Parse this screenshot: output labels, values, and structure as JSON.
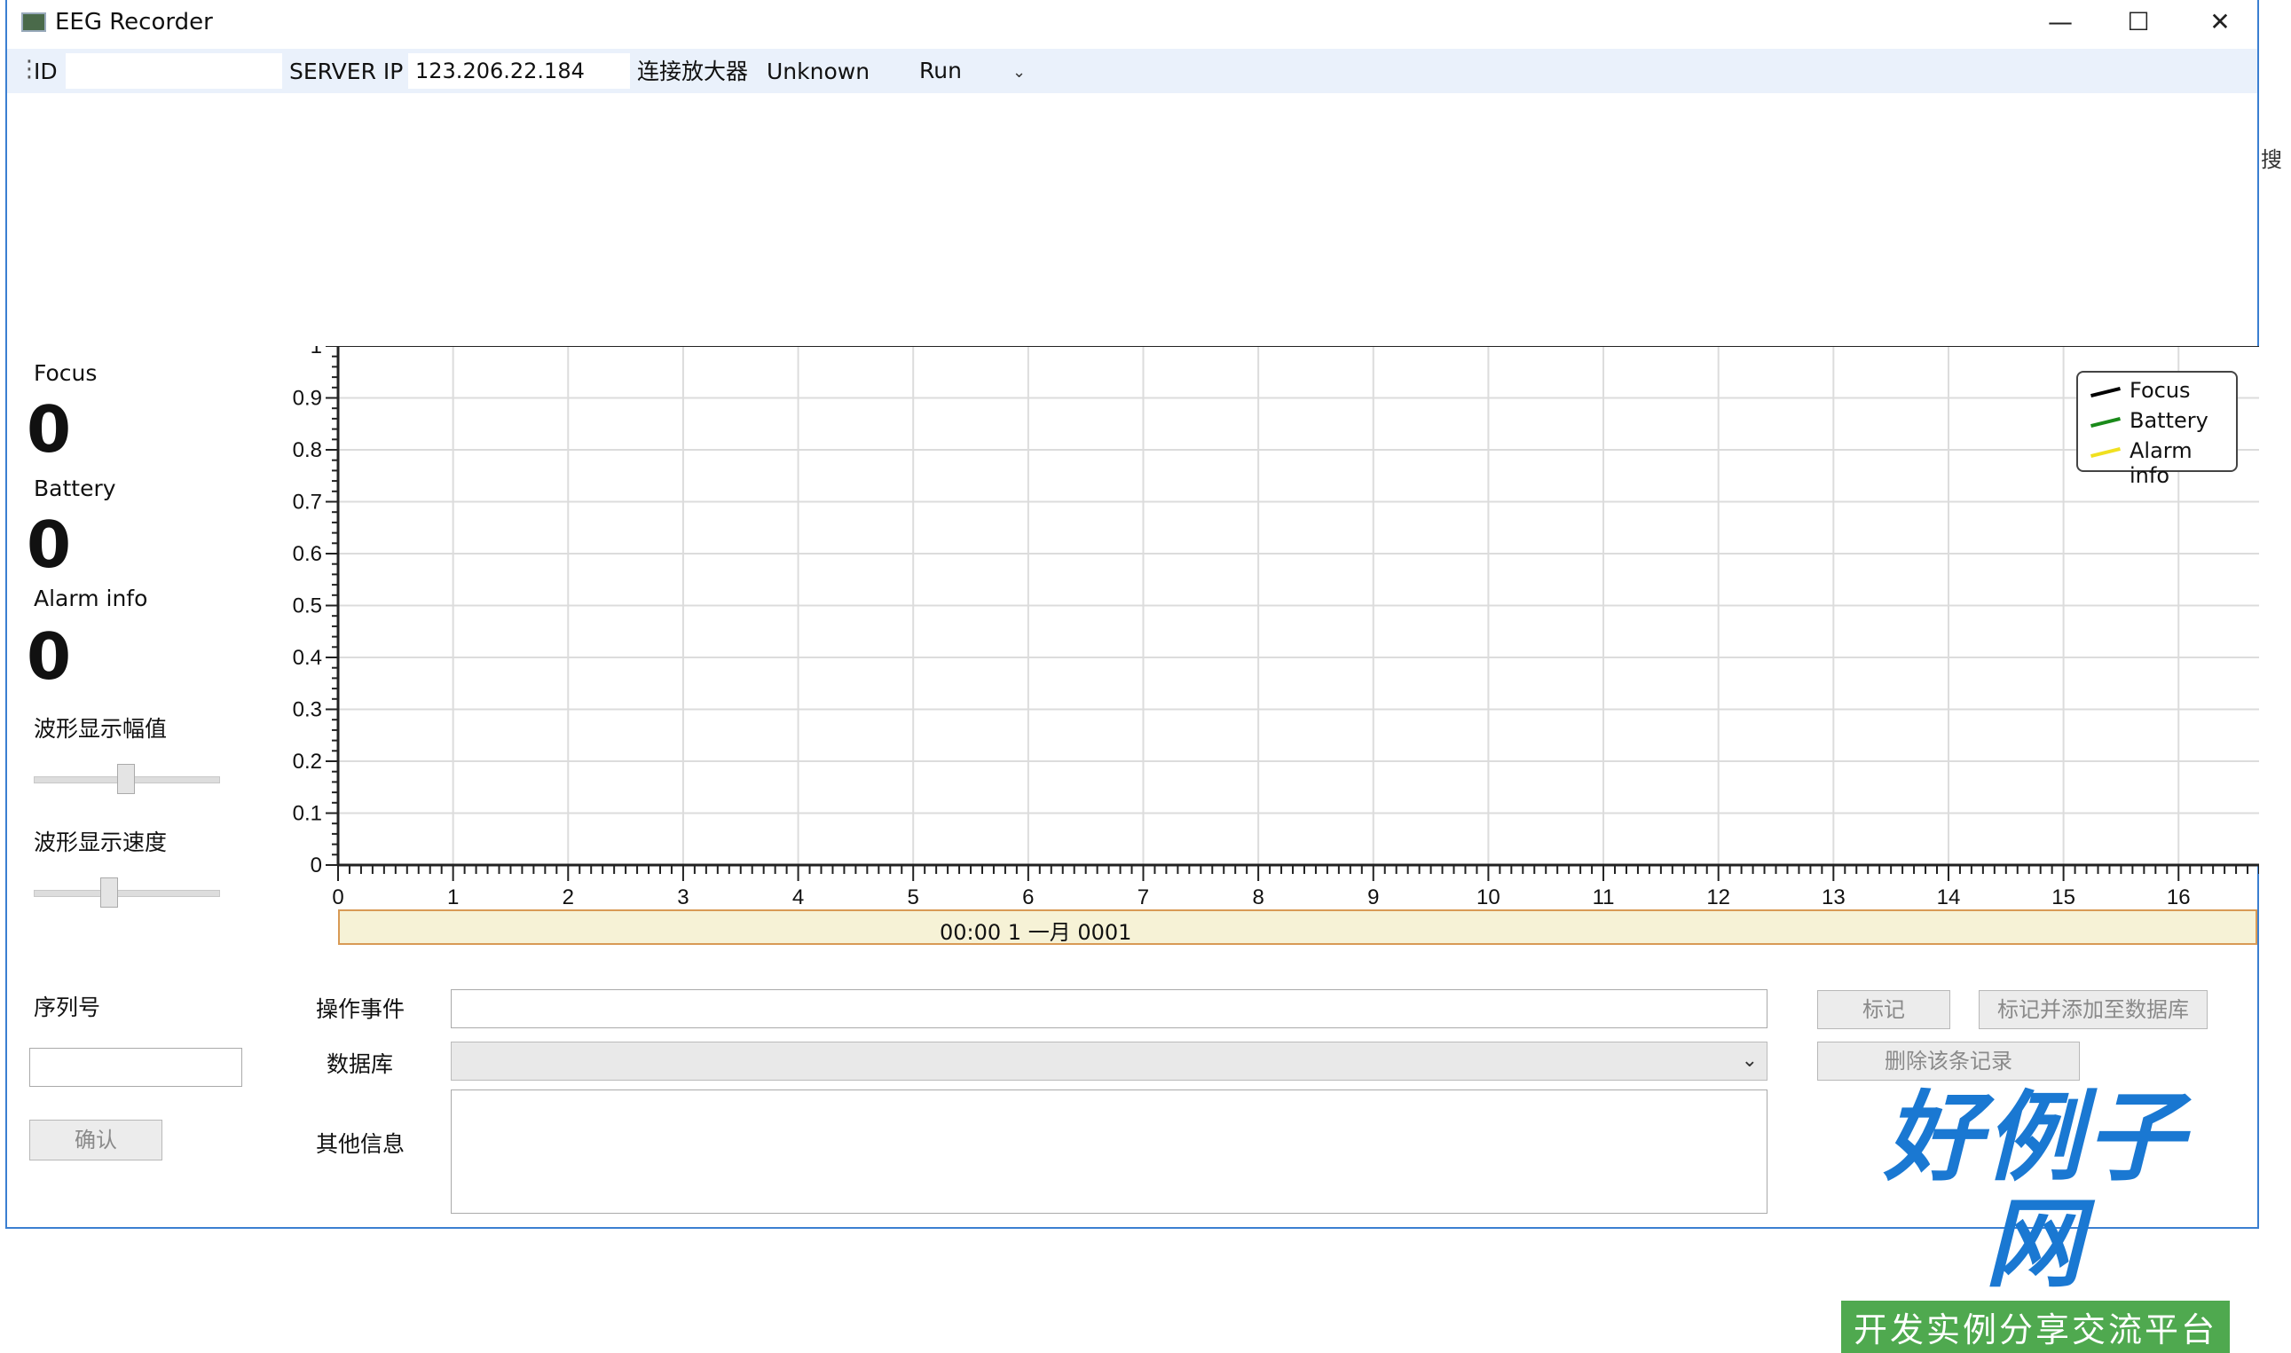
{
  "window": {
    "title": "EEG Recorder",
    "min_glyph": "—",
    "max_glyph": "☐",
    "close_glyph": "✕"
  },
  "toolbar": {
    "id_label": "ID",
    "id_value": "",
    "server_label": "SERVER IP",
    "server_value": "123.206.22.184",
    "amp_label": "连接放大器",
    "amp_status": "Unknown",
    "run_label": "Run",
    "dropdown_glyph": "⌄"
  },
  "side": {
    "focus_label": "Focus",
    "focus_value": "0",
    "battery_label": "Battery",
    "battery_value": "0",
    "alarm_label": "Alarm info",
    "alarm_value": "0",
    "amp_slider_label": "波形显示幅值",
    "amp_slider_level": 0.5,
    "speed_slider_label": "波形显示速度",
    "speed_slider_level": 0.4,
    "serial_label": "序列号",
    "serial_value": "",
    "confirm_label": "确认"
  },
  "chart_data": {
    "type": "line",
    "title": "",
    "xlabel": "",
    "ylabel": "",
    "xlim": [
      0,
      16.7
    ],
    "ylim": [
      0,
      1
    ],
    "x_ticks": [
      "0",
      "1",
      "2",
      "3",
      "4",
      "5",
      "6",
      "7",
      "8",
      "9",
      "10",
      "11",
      "12",
      "13",
      "14",
      "15",
      "16"
    ],
    "y_ticks": [
      "0",
      "0.1",
      "0.2",
      "0.3",
      "0.4",
      "0.5",
      "0.6",
      "0.7",
      "0.8",
      "0.9",
      "1"
    ],
    "grid": true,
    "legend_position": "top-right",
    "series": [
      {
        "name": "Focus",
        "color": "#000000",
        "values": []
      },
      {
        "name": "Battery",
        "color": "#008000",
        "values": []
      },
      {
        "name": "Alarm info",
        "color": "#ffff00",
        "values": []
      }
    ],
    "time_label": "00:00 1 一月 0001"
  },
  "form": {
    "event_label": "操作事件",
    "event_value": "",
    "db_label": "数据库",
    "db_selected": "",
    "other_label": "其他信息",
    "other_value": "",
    "mark_button": "标记",
    "mark_add_button": "标记并添加至数据库",
    "delete_button": "删除该条记录"
  },
  "watermark": {
    "logo_text": "好例子网",
    "tagline": "开发实例分享交流平台"
  },
  "right_edge_text": "搜"
}
